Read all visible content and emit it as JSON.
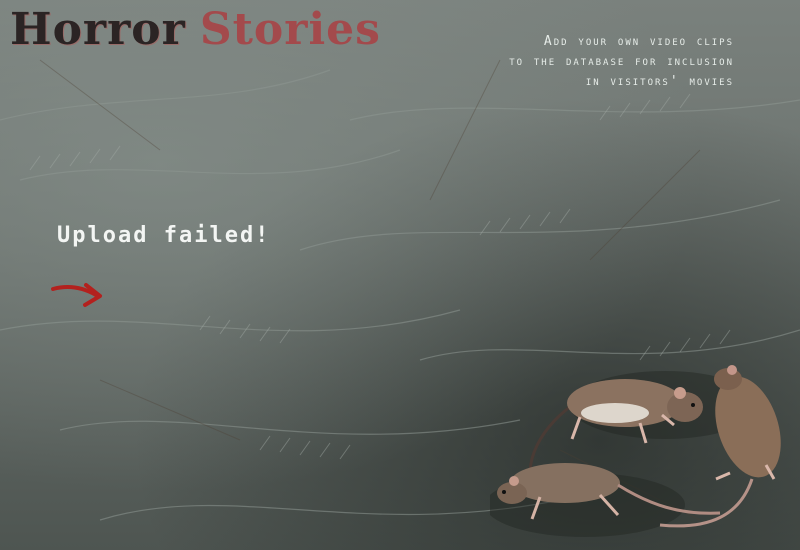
{
  "header": {
    "title_word_1": "Horror",
    "title_word_2": "Stories",
    "tagline_lines": [
      "Add your own video clips",
      "to the database for inclusion",
      "in visitors' movies"
    ]
  },
  "main": {
    "status_message": "Upload failed!",
    "arrow_icon": "arrow-right-icon"
  },
  "colors": {
    "title_dark": "#2b2424",
    "title_red": "#a34a4c",
    "arrow_red": "#b3211e",
    "text_light": "#f3f5f3"
  }
}
